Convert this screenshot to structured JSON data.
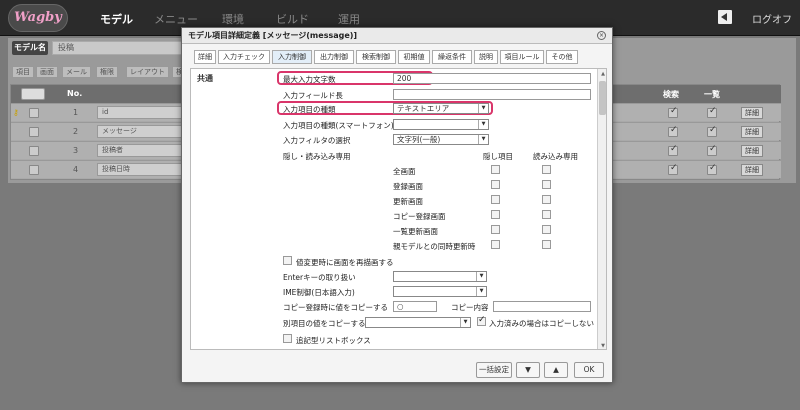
{
  "app": {
    "logo": "Wagby",
    "nav": [
      "モデル",
      "メニュー",
      "環境",
      "ビルド",
      "運用"
    ],
    "logout": "ログオフ"
  },
  "bg": {
    "model_name_label": "モデル名",
    "model_name_value": "投稿",
    "subtabs": [
      "項目",
      "画面",
      "メール",
      "権限",
      "レイアウト",
      "検"
    ],
    "headers": {
      "no": "No.",
      "search": "検索",
      "list": "一覧"
    },
    "rows": [
      {
        "no": "1",
        "id": "id",
        "search": true,
        "list": true,
        "detail": "詳細"
      },
      {
        "no": "2",
        "id": "メッセージ",
        "search": true,
        "list": true,
        "detail": "詳細"
      },
      {
        "no": "3",
        "id": "投稿者",
        "search": true,
        "list": true,
        "detail": "詳細"
      },
      {
        "no": "4",
        "id": "投稿日時",
        "search": true,
        "list": true,
        "detail": "詳細"
      }
    ]
  },
  "dialog": {
    "title": "モデル項目詳細定義 [メッセージ(message)]",
    "close": "×",
    "tabs": [
      "詳細",
      "入力チェック",
      "入力制御",
      "出力制御",
      "検索制御",
      "初期値",
      "繰返条件",
      "説明",
      "項目ルール",
      "その他"
    ],
    "section": "共通",
    "max_len": {
      "label": "最大入力文字数",
      "value": "200"
    },
    "field_len": {
      "label": "入力フィールド長",
      "value": ""
    },
    "input_type": {
      "label": "入力項目の種類",
      "value": "テキストエリア"
    },
    "input_type_sp": {
      "label": "入力項目の種類(スマートフォン)",
      "value": ""
    },
    "input_filter": {
      "label": "入力フィルタの選択",
      "value": "文字列(一般)"
    },
    "hidden": {
      "label": "隠し・読み込み専用",
      "col_hidden": "隠し項目",
      "col_readonly": "読み込み専用",
      "rows": [
        "全画面",
        "登録画面",
        "更新画面",
        "コピー登録画面",
        "一覧更新画面",
        "親モデルとの同時更新時"
      ]
    },
    "redraw": {
      "label": "値変更時に画面を再描画する"
    },
    "enter_key": {
      "label": "Enterキーの取り扱い",
      "value": ""
    },
    "ime": {
      "label": "IME制御(日本語入力)",
      "value": ""
    },
    "copy_on_copy": {
      "label": "コピー登録時に値をコピーする",
      "value": "○",
      "content_label": "コピー内容",
      "content_value": ""
    },
    "copy_other": {
      "label": "別項目の値をコピーする",
      "value": "",
      "skip_label": "入力済みの場合はコピーしない"
    },
    "adaptive": {
      "label": "追記型リストボックス"
    },
    "buttons": {
      "batch": "一括設定",
      "down": "▼",
      "up": "▲",
      "ok": "OK"
    }
  },
  "colors": {
    "highlight": "#d9356a",
    "topbar": "#2b2b2b"
  }
}
